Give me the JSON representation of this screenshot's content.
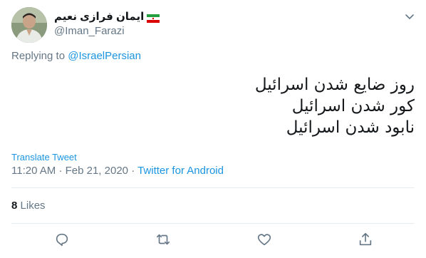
{
  "author": {
    "display_name": "ایمان فرازی نعیم",
    "handle": "@Iman_Farazi",
    "flag_icon": "iran-flag-icon"
  },
  "reply": {
    "prefix": "Replying to",
    "mention": "@IsraelPersian"
  },
  "tweet": {
    "lines": [
      "روز ضایع شدن اسرائیل",
      "کور شدن اسرائیل",
      "نابود شدن اسرائیل"
    ]
  },
  "translate_label": "Translate Tweet",
  "meta": {
    "time": "11:20 AM",
    "separator1": "·",
    "date": "Feb 21, 2020",
    "separator2": "·",
    "source": "Twitter for Android"
  },
  "stats": {
    "likes_count": "8",
    "likes_label": "Likes"
  },
  "actions": {
    "reply_icon": "reply-icon",
    "retweet_icon": "retweet-icon",
    "like_icon": "like-icon",
    "share_icon": "share-icon"
  },
  "colors": {
    "accent": "#1b95e0",
    "muted": "#657786",
    "text": "#14171a",
    "divider": "#e6ecf0"
  }
}
